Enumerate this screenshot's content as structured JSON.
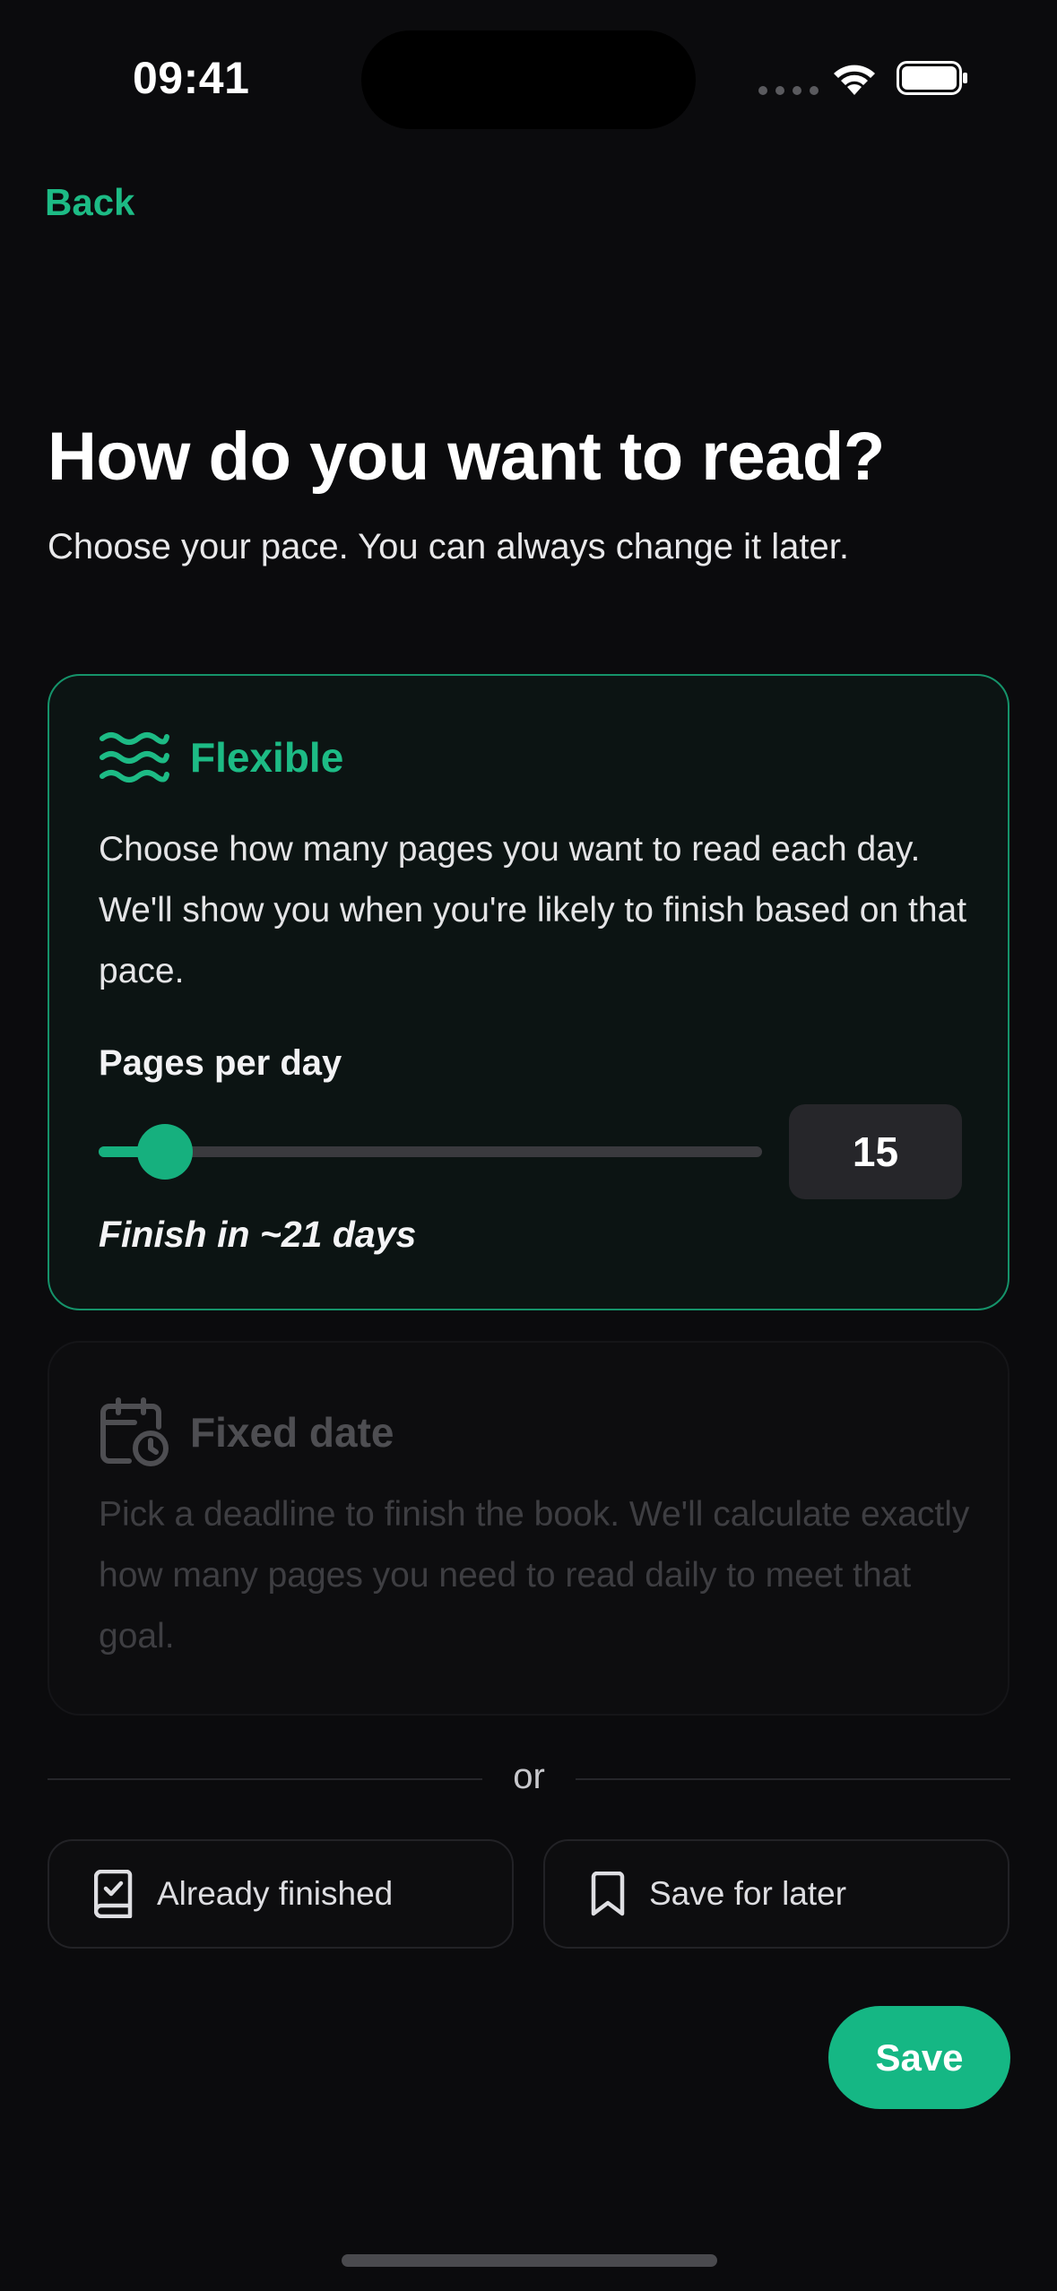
{
  "status_bar": {
    "time": "09:41",
    "signal_icon": "cellular-signal-icon",
    "wifi_icon": "wifi-icon",
    "battery_icon": "battery-icon"
  },
  "nav": {
    "back_label": "Back"
  },
  "header": {
    "title": "How do you want to read?",
    "subtitle": "Choose your pace. You can always change it later."
  },
  "options": {
    "flexible": {
      "icon": "waves-icon",
      "title": "Flexible",
      "description": "Choose how many pages you want to read each day. We'll show you when you're likely to finish based on that pace.",
      "selected": true,
      "pages_label": "Pages per day",
      "pages_value": "15",
      "slider_fraction": 0.1,
      "finish_text": "Finish in ~21 days"
    },
    "fixed_date": {
      "icon": "calendar-clock-icon",
      "title": "Fixed date",
      "description": "Pick a deadline to finish the book. We'll calculate exactly how many pages you need to read daily to meet that goal.",
      "selected": false
    }
  },
  "divider": {
    "label": "or"
  },
  "secondary_actions": {
    "already_finished": {
      "icon": "book-check-icon",
      "label": "Already finished"
    },
    "save_for_later": {
      "icon": "bookmark-icon",
      "label": "Save for later"
    }
  },
  "primary_action": {
    "label": "Save"
  },
  "colors": {
    "accent": "#15b784",
    "background": "#0b0b0d",
    "selected_border": "#15936a"
  }
}
